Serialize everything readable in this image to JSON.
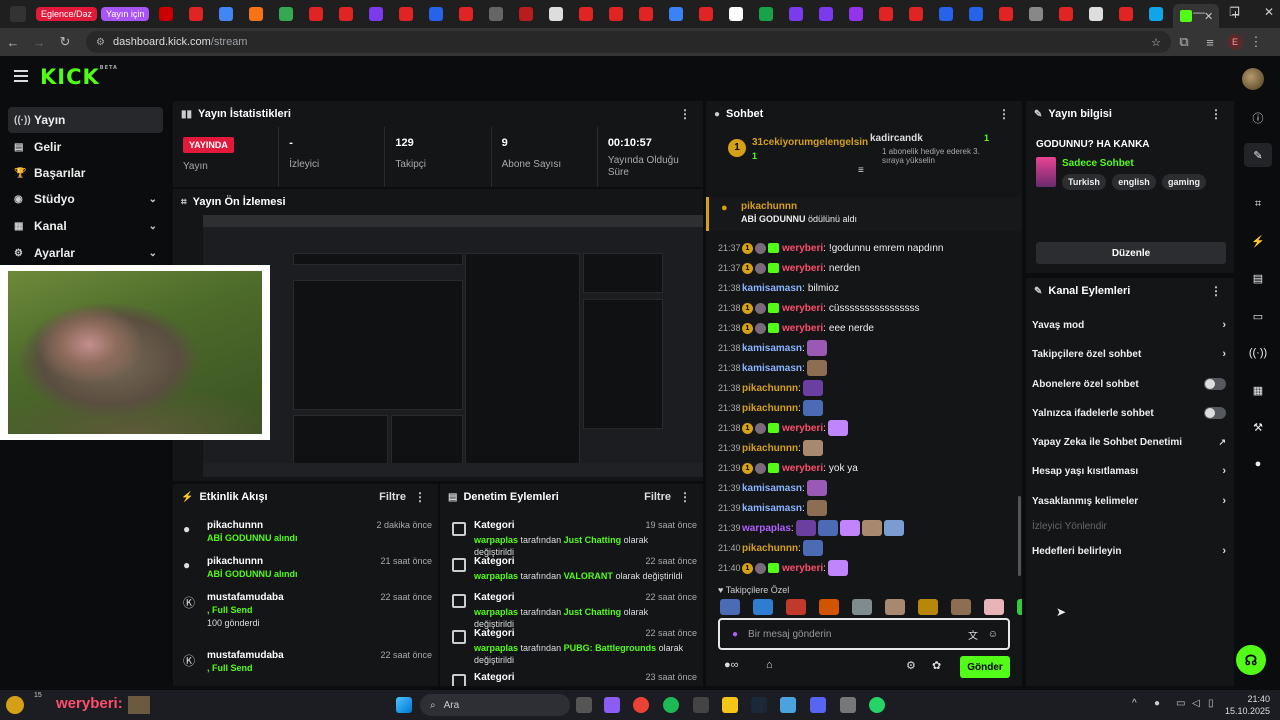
{
  "browser": {
    "tab_pills": [
      {
        "label": "Eglence/Dəz",
        "color": "#e11a3b"
      },
      {
        "label": "Yayın için",
        "color": "#a855f7"
      }
    ],
    "url_domain": "dashboard.kick.com",
    "url_path": "/stream",
    "profile_letter": "E"
  },
  "sidebar": {
    "items": [
      {
        "icon": "stream-icon",
        "glyph": "((·))",
        "label": "Yayın"
      },
      {
        "icon": "revenue-icon",
        "glyph": "▤",
        "label": "Gelir"
      },
      {
        "icon": "trophy-icon",
        "glyph": "🏆",
        "label": "Başarılar"
      },
      {
        "icon": "studio-icon",
        "glyph": "◉",
        "label": "Stüdyo"
      },
      {
        "icon": "channel-icon",
        "glyph": "▦",
        "label": "Kanal"
      },
      {
        "icon": "settings-icon",
        "glyph": "⚙",
        "label": "Ayarlar"
      }
    ]
  },
  "stats": {
    "title": "Yayın İstatistikleri",
    "live": "YAYINDA",
    "live_label": "Yayın",
    "items": [
      {
        "value": "-",
        "label": "İzleyici"
      },
      {
        "value": "129",
        "label": "Takipçi"
      },
      {
        "value": "9",
        "label": "Abone Sayısı"
      },
      {
        "value": "00:10:57",
        "label": "Yayında Olduğu Süre"
      }
    ]
  },
  "preview": {
    "title": "Yayın Ön İzlemesi"
  },
  "activity": {
    "title": "Etkinlik Akışı",
    "filter": "Filtre",
    "items": [
      {
        "name": "pikachunnn",
        "sub": "ABİ GODUNNU alındı",
        "extra": "",
        "time": "2 dakika önce"
      },
      {
        "name": "pikachunnn",
        "sub": "ABİ GODUNNU alındı",
        "extra": "",
        "time": "21 saat önce"
      },
      {
        "name": "mustafamudaba",
        "sub": ", Full Send",
        "extra": "100 gönderdi",
        "time": "22 saat önce"
      },
      {
        "name": "mustafamudaba",
        "sub": ", Full Send",
        "extra": "",
        "time": "22 saat önce"
      }
    ]
  },
  "moderation": {
    "title": "Denetim Eylemleri",
    "filter": "Filtre",
    "items": [
      {
        "title": "Kategori",
        "user": "warpaplas",
        "mid": "tarafından",
        "cat": "Just Chatting",
        "end": "olarak değiştirildi",
        "time": "19 saat önce"
      },
      {
        "title": "Kategori",
        "user": "warpaplas",
        "mid": "tarafından",
        "cat": "VALORANT",
        "end": "olarak değiştirildi",
        "time": "22 saat önce"
      },
      {
        "title": "Kategori",
        "user": "warpaplas",
        "mid": "tarafından",
        "cat": "Just Chatting",
        "end": "olarak değiştirildi",
        "time": "22 saat önce"
      },
      {
        "title": "Kategori",
        "user": "warpaplas",
        "mid": "tarafından",
        "cat": "PUBG: Battlegrounds",
        "end": "olarak değiştirildi",
        "time": "22 saat önce"
      },
      {
        "title": "Kategori",
        "user": "",
        "mid": "",
        "cat": "",
        "end": "",
        "time": "23 saat önce"
      }
    ]
  },
  "chat": {
    "title": "Sohbet",
    "pinned_left_user": "31cekiyorumgelengelsin",
    "pinned_left_num": "1",
    "pinned_right_user": "kadircandk",
    "pinned_right_num": "1",
    "pinned_right_msg": "1 abonelik hediye ederek 3. sıraya yükselin",
    "reward_user": "pikachunnn",
    "reward_text": "ABİ GODUNNU",
    "reward_suffix": "ödülünü aldı",
    "messages": [
      {
        "time": "21:37",
        "user": "weryberi",
        "badges": true,
        "color": "#ff4d6d",
        "text": "!godunnu emrem napdınn"
      },
      {
        "time": "21:37",
        "user": "weryberi",
        "badges": true,
        "color": "#ff4d6d",
        "text": "nerden"
      },
      {
        "time": "21:38",
        "user": "kamisamasn",
        "badges": false,
        "color": "#8ab4ff",
        "text": "bilmioz"
      },
      {
        "time": "21:38",
        "user": "weryberi",
        "badges": true,
        "color": "#ff4d6d",
        "text": "cüssssssssssssssss"
      },
      {
        "time": "21:38",
        "user": "weryberi",
        "badges": true,
        "color": "#ff4d6d",
        "text": "eee nerde"
      },
      {
        "time": "21:38",
        "user": "kamisamasn",
        "badges": false,
        "color": "#8ab4ff",
        "text": ""
      },
      {
        "time": "21:38",
        "user": "kamisamasn",
        "badges": false,
        "color": "#8ab4ff",
        "text": ""
      },
      {
        "time": "21:38",
        "user": "pikachunnn",
        "badges": false,
        "color": "#d4a017",
        "text": ""
      },
      {
        "time": "21:38",
        "user": "pikachunnn",
        "badges": false,
        "color": "#d4a017",
        "text": ""
      },
      {
        "time": "21:38",
        "user": "weryberi",
        "badges": true,
        "color": "#ff4d6d",
        "text": ""
      },
      {
        "time": "21:39",
        "user": "pikachunnn",
        "badges": false,
        "color": "#d4a017",
        "text": ""
      },
      {
        "time": "21:39",
        "user": "weryberi",
        "badges": true,
        "color": "#ff4d6d",
        "text": "yok ya"
      },
      {
        "time": "21:39",
        "user": "kamisamasn",
        "badges": false,
        "color": "#8ab4ff",
        "text": ""
      },
      {
        "time": "21:39",
        "user": "kamisamasn",
        "badges": false,
        "color": "#8ab4ff",
        "text": ""
      },
      {
        "time": "21:39",
        "user": "warpaplas",
        "badges": false,
        "color": "#b060ff",
        "text": ""
      },
      {
        "time": "21:40",
        "user": "pikachunnn",
        "badges": false,
        "color": "#d4a017",
        "text": ""
      },
      {
        "time": "21:40",
        "user": "weryberi",
        "badges": true,
        "color": "#ff4d6d",
        "text": ""
      }
    ],
    "emote_bar_label": "Takipçilere Özel",
    "input_placeholder": "Bir mesaj gönderin",
    "send": "Gönder"
  },
  "info": {
    "title": "Yayın bilgisi",
    "stream_title": "GODUNNU? HA KANKA",
    "category": "Sadece Sohbet",
    "tags": [
      "Turkish",
      "english",
      "gaming"
    ],
    "edit": "Düzenle"
  },
  "actions": {
    "title": "Kanal Eylemleri",
    "items": [
      {
        "label": "Yavaş mod",
        "kind": "chevron"
      },
      {
        "label": "Takipçilere özel sohbet",
        "kind": "chevron"
      },
      {
        "label": "Abonelere özel sohbet",
        "kind": "toggle"
      },
      {
        "label": "Yalnızca ifadelerle sohbet",
        "kind": "toggle"
      },
      {
        "label": "Yapay Zeka ile Sohbet Denetimi",
        "kind": "external"
      },
      {
        "label": "Hesap yaşı kısıtlaması",
        "kind": "chevron"
      },
      {
        "label": "Yasaklanmış kelimeler",
        "kind": "chevron"
      },
      {
        "label": "İzleyici Yönlendir",
        "kind": "dim"
      },
      {
        "label": "Hedefleri belirleyin",
        "kind": "chevron"
      }
    ]
  },
  "taskbar": {
    "left_user": "weryberi:",
    "left_badge": "15",
    "search": "Ara",
    "time": "21:40",
    "date": "15.10.2025"
  },
  "colors": {
    "kick_green": "#53fc18",
    "live_red": "#e11a3b",
    "panel": "#141517",
    "bg": "#0b0c0d"
  }
}
